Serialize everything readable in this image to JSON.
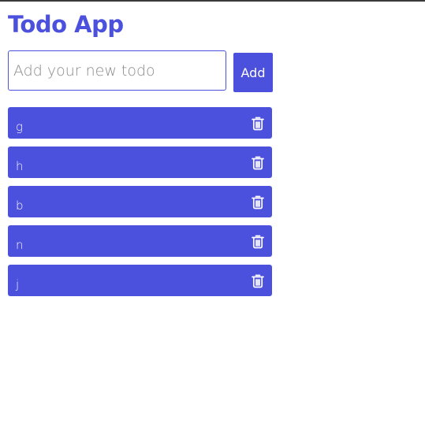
{
  "colors": {
    "accent": "#4c51dd"
  },
  "header": {
    "title": "Todo App"
  },
  "form": {
    "placeholder": "Add your new todo",
    "value": "",
    "add_label": "Add"
  },
  "todos": [
    {
      "text": "g",
      "icon": "trash-icon"
    },
    {
      "text": "h",
      "icon": "trash-icon"
    },
    {
      "text": "b",
      "icon": "trash-icon"
    },
    {
      "text": "n",
      "icon": "trash-icon"
    },
    {
      "text": "j",
      "icon": "trash-icon"
    }
  ]
}
